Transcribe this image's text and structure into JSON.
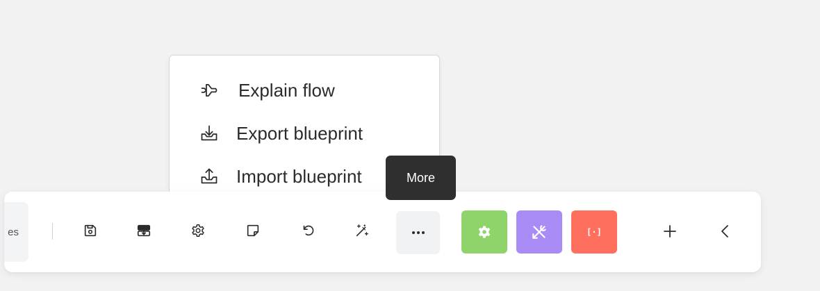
{
  "menu": {
    "items": [
      {
        "label": "Explain flow",
        "icon": "plane-icon"
      },
      {
        "label": "Export blueprint",
        "icon": "download-tray-icon"
      },
      {
        "label": "Import blueprint",
        "icon": "upload-tray-icon"
      }
    ]
  },
  "tooltip": {
    "text": "More"
  },
  "toolbar": {
    "partial_label": "es",
    "tools": [
      {
        "name": "save-icon"
      },
      {
        "name": "auto-align-icon"
      },
      {
        "name": "settings-gear-icon"
      },
      {
        "name": "note-icon"
      },
      {
        "name": "undo-icon"
      },
      {
        "name": "magic-wand-icon"
      }
    ],
    "more_icon": "ellipsis-icon",
    "apps": [
      {
        "name": "green-gear-app",
        "color": "#8fd36b"
      },
      {
        "name": "purple-tools-app",
        "color": "#a98bf5"
      },
      {
        "name": "red-bracket-app",
        "color": "#ff6f5e",
        "label": "[·]"
      }
    ]
  }
}
